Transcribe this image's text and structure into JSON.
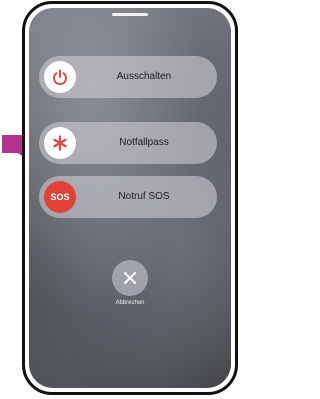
{
  "screen": {
    "actions": [
      {
        "label": "Ausschalten",
        "icon": "power-icon"
      },
      {
        "label": "Notfallpass",
        "icon": "medical-asterisk-icon"
      },
      {
        "label": "Notruf SOS",
        "icon": "sos-icon",
        "icon_text": "SOS"
      }
    ],
    "cancel": {
      "label": "Abbrechen",
      "icon": "close-icon"
    }
  },
  "annotation": {
    "pointer": "pointing-hand-icon",
    "color": "#b5318f"
  },
  "colors": {
    "power_red": "#e5453a",
    "sos_red": "#e24338"
  }
}
